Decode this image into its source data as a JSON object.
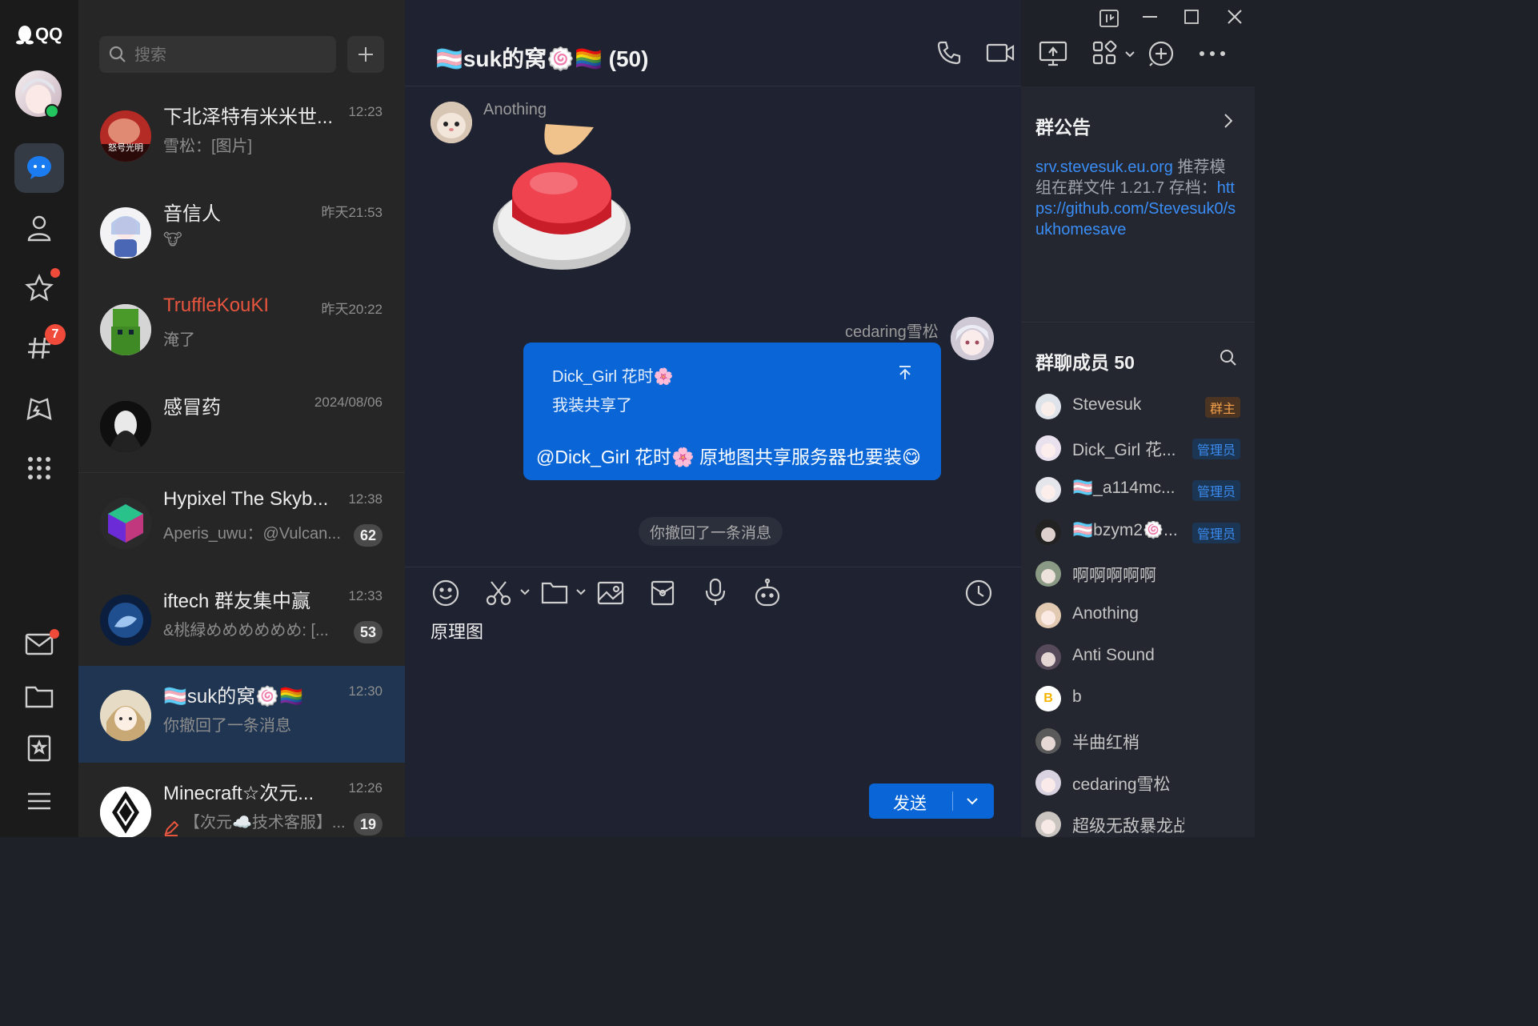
{
  "app": {
    "logo_text": "QQ"
  },
  "rail": {
    "messages_badge": "7"
  },
  "search": {
    "placeholder": "搜索"
  },
  "conversations": [
    {
      "name": "下北泽特有米米世...",
      "time": "12:23",
      "preview": "雪松：[图片]",
      "unread": "",
      "avatar_caption": "怒号光明"
    },
    {
      "name": "音信人",
      "time": "昨天21:53",
      "preview": "🐮",
      "unread": ""
    },
    {
      "name": "TruffleKouKI",
      "time": "昨天20:22",
      "preview": "淹了",
      "unread": "",
      "name_color": "#e8553f"
    },
    {
      "name": "感冒药",
      "time": "2024/08/06",
      "preview": "",
      "unread": ""
    },
    {
      "name": "Hypixel The Skyb...",
      "time": "12:38",
      "preview": "Aperis_uwu：@Vulcan...",
      "unread": "62"
    },
    {
      "name": "iftech 群友集中赢",
      "time": "12:33",
      "preview": "&桃緑めめめめめめ: [...",
      "unread": "53"
    },
    {
      "name": "🏳️‍⚧️suk的窝🍥🏳️‍🌈",
      "time": "12:30",
      "preview": "你撤回了一条消息",
      "unread": ""
    },
    {
      "name": "Minecraft☆次元...",
      "time": "12:26",
      "preview": "【次元☁️技术客服】...",
      "unread": "19"
    }
  ],
  "chat": {
    "title": "🏳️‍⚧️suk的窝🍥🏳️‍🌈 (50)",
    "messages": [
      {
        "sender": "Anothing",
        "type": "sticker"
      },
      {
        "sender": "cedaring雪松",
        "quote_name": "Dick_Girl 花时🌸",
        "quote_text": "我装共享了",
        "text": "@Dick_Girl 花时🌸 原地图共享服务器也要装😋"
      }
    ],
    "recall_notice": "你撤回了一条消息",
    "input_value": "原理图",
    "send_label": "发送"
  },
  "side": {
    "notice_title": "群公告",
    "notice_link1": "srv.stevesuk.eu.org",
    "notice_text": " 推荐模组在群文件 1.21.7 存档：",
    "notice_link2": "https://github.com/Stevesuk0/sukhomesave",
    "members_title": "群聊成员 50",
    "members": [
      {
        "name": "Stevesuk",
        "role": "群主"
      },
      {
        "name": "Dick_Girl 花...",
        "role": "管理员"
      },
      {
        "name": "🏳️‍⚧️_a114mc...",
        "role": "管理员"
      },
      {
        "name": "🏳️‍⚧️bzym2🍥...",
        "role": "管理员"
      },
      {
        "name": "啊啊啊啊啊",
        "role": ""
      },
      {
        "name": "Anothing",
        "role": ""
      },
      {
        "name": "Anti Sound",
        "role": ""
      },
      {
        "name": "b",
        "role": ""
      },
      {
        "name": "半曲红梢",
        "role": ""
      },
      {
        "name": "cedaring雪松",
        "role": ""
      },
      {
        "name": "超级无敌暴龙战士",
        "role": ""
      }
    ]
  },
  "colors": {
    "accent": "#0a66d6",
    "badge_red": "#f04a3a",
    "link": "#3a8df5",
    "owner_tag": "#f29f4a"
  }
}
